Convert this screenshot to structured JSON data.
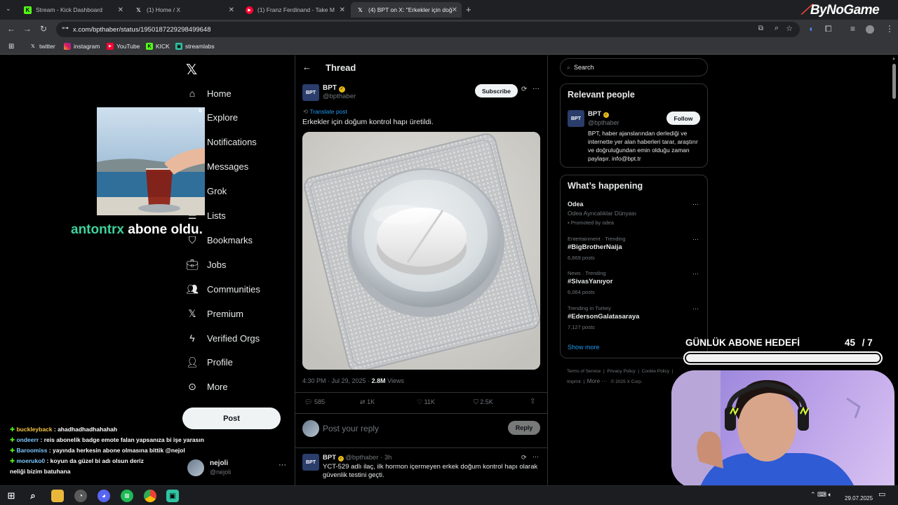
{
  "browser": {
    "tabs": [
      {
        "title": "Stream - Kick Dashboard",
        "favicon": "kick-icon",
        "color": "#53fc18"
      },
      {
        "title": "(1) Home / X",
        "favicon": "x-icon",
        "color": "#ffffff"
      },
      {
        "title": "(1) Franz Ferdinand - Take M",
        "favicon": "youtube-icon",
        "color": "#ff0033"
      },
      {
        "title": "(4) BPT on X: \"Erkekler için doğ",
        "favicon": "x-icon",
        "color": "#ffffff"
      }
    ],
    "url": "x.com/bpthaber/status/1950187229298499648",
    "bookmarks": [
      "twitter",
      "instagram",
      "YouTube",
      "KICK",
      "streamlabs"
    ],
    "watermark": "ByNoGame"
  },
  "nav": {
    "items": [
      {
        "label": "Home",
        "icon": "home-icon"
      },
      {
        "label": "Explore",
        "icon": "search-icon"
      },
      {
        "label": "Notifications",
        "icon": "bell-icon"
      },
      {
        "label": "Messages",
        "icon": "mail-icon"
      },
      {
        "label": "Grok",
        "icon": "grok-icon"
      },
      {
        "label": "Lists",
        "icon": "list-icon"
      },
      {
        "label": "Bookmarks",
        "icon": "bookmark-icon"
      },
      {
        "label": "Jobs",
        "icon": "briefcase-icon"
      },
      {
        "label": "Communities",
        "icon": "people-icon"
      },
      {
        "label": "Premium",
        "icon": "x-icon"
      },
      {
        "label": "Verified Orgs",
        "icon": "lightning-icon"
      },
      {
        "label": "Profile",
        "icon": "person-icon"
      },
      {
        "label": "More",
        "icon": "more-circle-icon"
      }
    ],
    "post_button": "Post",
    "account": {
      "name": "nejoli",
      "handle": "@nejoli"
    }
  },
  "thread": {
    "title": "Thread",
    "author": {
      "name": "BPT",
      "handle": "@bpthaber",
      "avatar": "BPT"
    },
    "subscribe": "Subscribe",
    "translate": "Translate post",
    "text": "Erkekler için doğum kontrol hapı üretildi.",
    "time": "4:30 PM · Jul 29, 2025 ·",
    "views_count": "2.8M",
    "views_label": "Views",
    "stats": {
      "replies": "585",
      "reposts": "1K",
      "likes": "11K",
      "bookmarks": "2.5K"
    },
    "reply_placeholder": "Post your reply",
    "reply_button": "Reply",
    "next": {
      "name": "BPT",
      "handle": "@bpthaber · 3h",
      "text": "YCT-529 adlı ilaç, ilk hormon içermeyen erkek doğum kontrol hapı olarak güvenlik testini geçti."
    }
  },
  "sidebar": {
    "search_placeholder": "Search",
    "relevant": {
      "title": "Relevant people",
      "name": "BPT",
      "handle": "@bpthaber",
      "follow": "Follow",
      "bio": "BPT, haber ajanslarından derlediği ve internette yer alan haberleri tarar, araştırır ve doğruluğundan emin olduğu zaman paylaşır. info@bpt.tr"
    },
    "happening": {
      "title": "What’s happening",
      "items": [
        {
          "top": "Odea",
          "sub": "Odea Ayrıcalıklar Dünyası",
          "meta": "Promoted by odea"
        },
        {
          "top": "Entertainment · Trending",
          "sub": "#BigBrotherNaija",
          "meta": "6,669 posts"
        },
        {
          "top": "News · Trending",
          "sub": "#SivasYanıyor",
          "meta": "6,064 posts"
        },
        {
          "top": "Trending in Turkey",
          "sub": "#EdersonGalatasaraya",
          "meta": "7,127 posts"
        }
      ],
      "show_more": "Show more"
    },
    "footer": [
      "Terms of Service",
      "Privacy Policy",
      "Cookie Policy",
      "Imprint",
      "More ···",
      "© 2025 X Corp."
    ]
  },
  "overlay": {
    "sub_alert_name": "antontrx",
    "sub_alert_text": "abone oldu.",
    "goal_title": "GÜNLÜK ABONE HEDEFİ",
    "goal_current": "45",
    "goal_target": "/ 7",
    "chat": [
      {
        "user": "buckleyback",
        "msg": ": ahadhadhadhahahah",
        "color": "#f5c542"
      },
      {
        "user": "ondeerr",
        "msg": ": reis abonelik badge emote falan yapsanıza bi işe yarasın",
        "color": "#7ec8ff"
      },
      {
        "user": "Baroomiss",
        "msg": ": yayında herkesin abone olmasına bittik @nejol",
        "color": "#7ec8ff"
      },
      {
        "user": "moeruko0",
        "msg": ": koyun da güzel bi adı olsun deriz",
        "color": "#7ec8ff"
      },
      {
        "user": "",
        "msg": "neliği bizim batuhana",
        "color": "#ffffff"
      }
    ]
  },
  "taskbar": {
    "date": "29.07.2025"
  }
}
